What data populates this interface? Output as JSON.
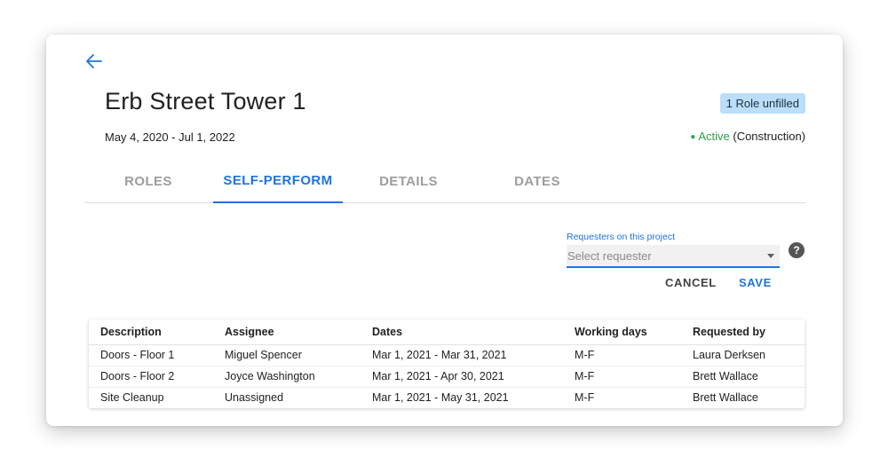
{
  "project": {
    "title": "Erb Street Tower 1",
    "date_range": "May 4, 2020 - Jul 1, 2022",
    "role_badge": "1 Role unfilled",
    "status_active": "Active",
    "status_phase": "(Construction)"
  },
  "colors": {
    "accent": "#1e74e0",
    "active_green": "#2e9e4f",
    "badge_bg": "#bbdefb"
  },
  "tabs": [
    {
      "label": "ROLES",
      "active": false
    },
    {
      "label": "SELF-PERFORM",
      "active": true
    },
    {
      "label": "DETAILS",
      "active": false
    },
    {
      "label": "DATES",
      "active": false
    }
  ],
  "requesters": {
    "label": "Requesters on this project",
    "placeholder": "Select requester",
    "help_glyph": "?"
  },
  "actions": {
    "cancel_label": "CANCEL",
    "save_label": "SAVE"
  },
  "table": {
    "headers": [
      "Description",
      "Assignee",
      "Dates",
      "Working days",
      "Requested by"
    ],
    "rows": [
      [
        "Doors - Floor 1",
        "Miguel Spencer",
        "Mar 1, 2021 - Mar 31, 2021",
        "M-F",
        "Laura Derksen"
      ],
      [
        "Doors - Floor 2",
        "Joyce Washington",
        "Mar 1, 2021 - Apr 30, 2021",
        "M-F",
        "Brett Wallace"
      ],
      [
        "Site Cleanup",
        "Unassigned",
        "Mar 1, 2021 - May 31, 2021",
        "M-F",
        "Brett Wallace"
      ]
    ]
  },
  "icons": {
    "back": "arrow-left-icon",
    "dropdown": "caret-down-icon",
    "help": "help-circle-icon"
  }
}
